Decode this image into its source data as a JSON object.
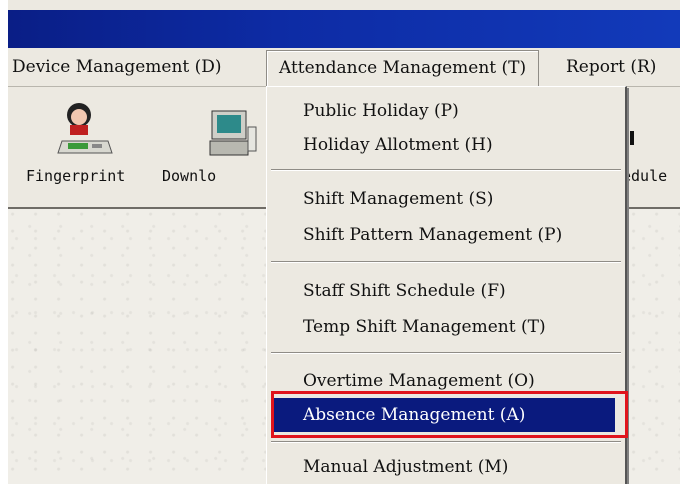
{
  "menubar": {
    "items": [
      {
        "label": "Device Management (D)"
      },
      {
        "label": "Attendance Management (T)"
      },
      {
        "label": "Report (R)"
      }
    ]
  },
  "toolbar": {
    "buttons": [
      {
        "label": "Fingerprint",
        "icon": "fingerprint-reader-icon"
      },
      {
        "label": "Downlo",
        "icon": "computer-download-icon"
      },
      {
        "label": "edule",
        "icon": "schedule-icon"
      }
    ]
  },
  "attendance_menu": {
    "groups": [
      [
        "Public Holiday (P)",
        "Holiday Allotment (H)"
      ],
      [
        "Shift Management (S)",
        "Shift Pattern Management (P)"
      ],
      [
        "Staff Shift Schedule (F)",
        "Temp Shift Management (T)"
      ],
      [
        "Overtime Management (O)",
        "Absence Management (A)"
      ],
      [
        "Manual Adjustment (M)"
      ]
    ],
    "selected": "Absence Management (A)"
  },
  "colors": {
    "titlebar": "#0d2ba4",
    "selection": "#0a1a7e",
    "highlight_border": "#e0141c",
    "menu_background": "#ece9e1"
  }
}
